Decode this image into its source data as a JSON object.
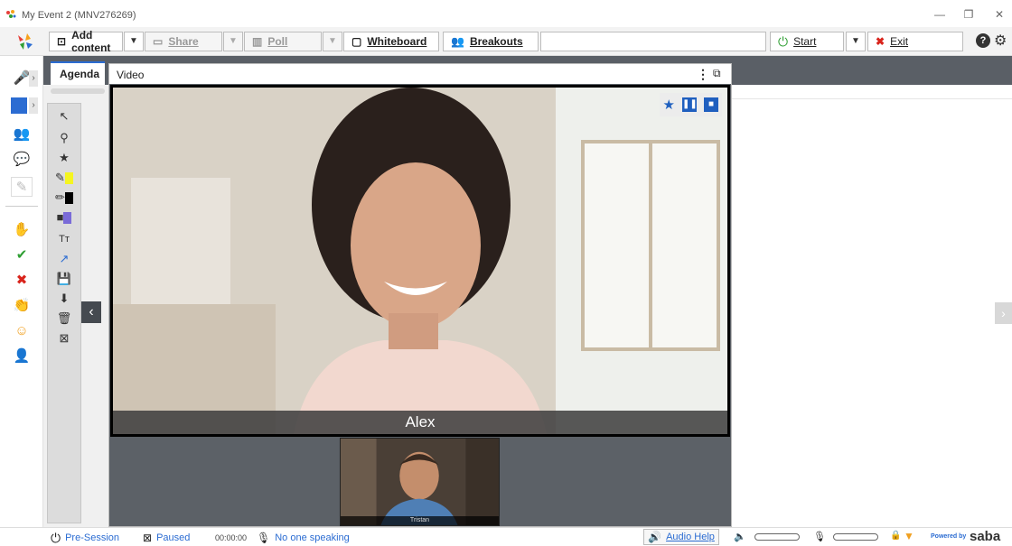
{
  "window": {
    "title": "My Event 2 (MNV276269)",
    "controls": [
      "—",
      "❐",
      "✕"
    ]
  },
  "toolbar": {
    "add_content": "Add content",
    "share": "Share",
    "poll": "Poll",
    "whiteboard": "Whiteboard",
    "breakouts": "Breakouts",
    "start": "Start",
    "exit": "Exit",
    "colors": {
      "start": "#2e9e32",
      "exit": "#d9241c"
    }
  },
  "tabs": [
    {
      "label": "Agenda",
      "active": true
    },
    {
      "label": "Video",
      "active": false
    }
  ],
  "video": {
    "main_speaker": "Alex",
    "thumbnail_name": "Tristan"
  },
  "status": {
    "session": "Pre-Session",
    "recording": "Paused",
    "timer": "00:00:00",
    "speaking": "No one speaking",
    "audio_help": "Audio Help",
    "powered_by": "Powered by",
    "brand": "saba"
  }
}
